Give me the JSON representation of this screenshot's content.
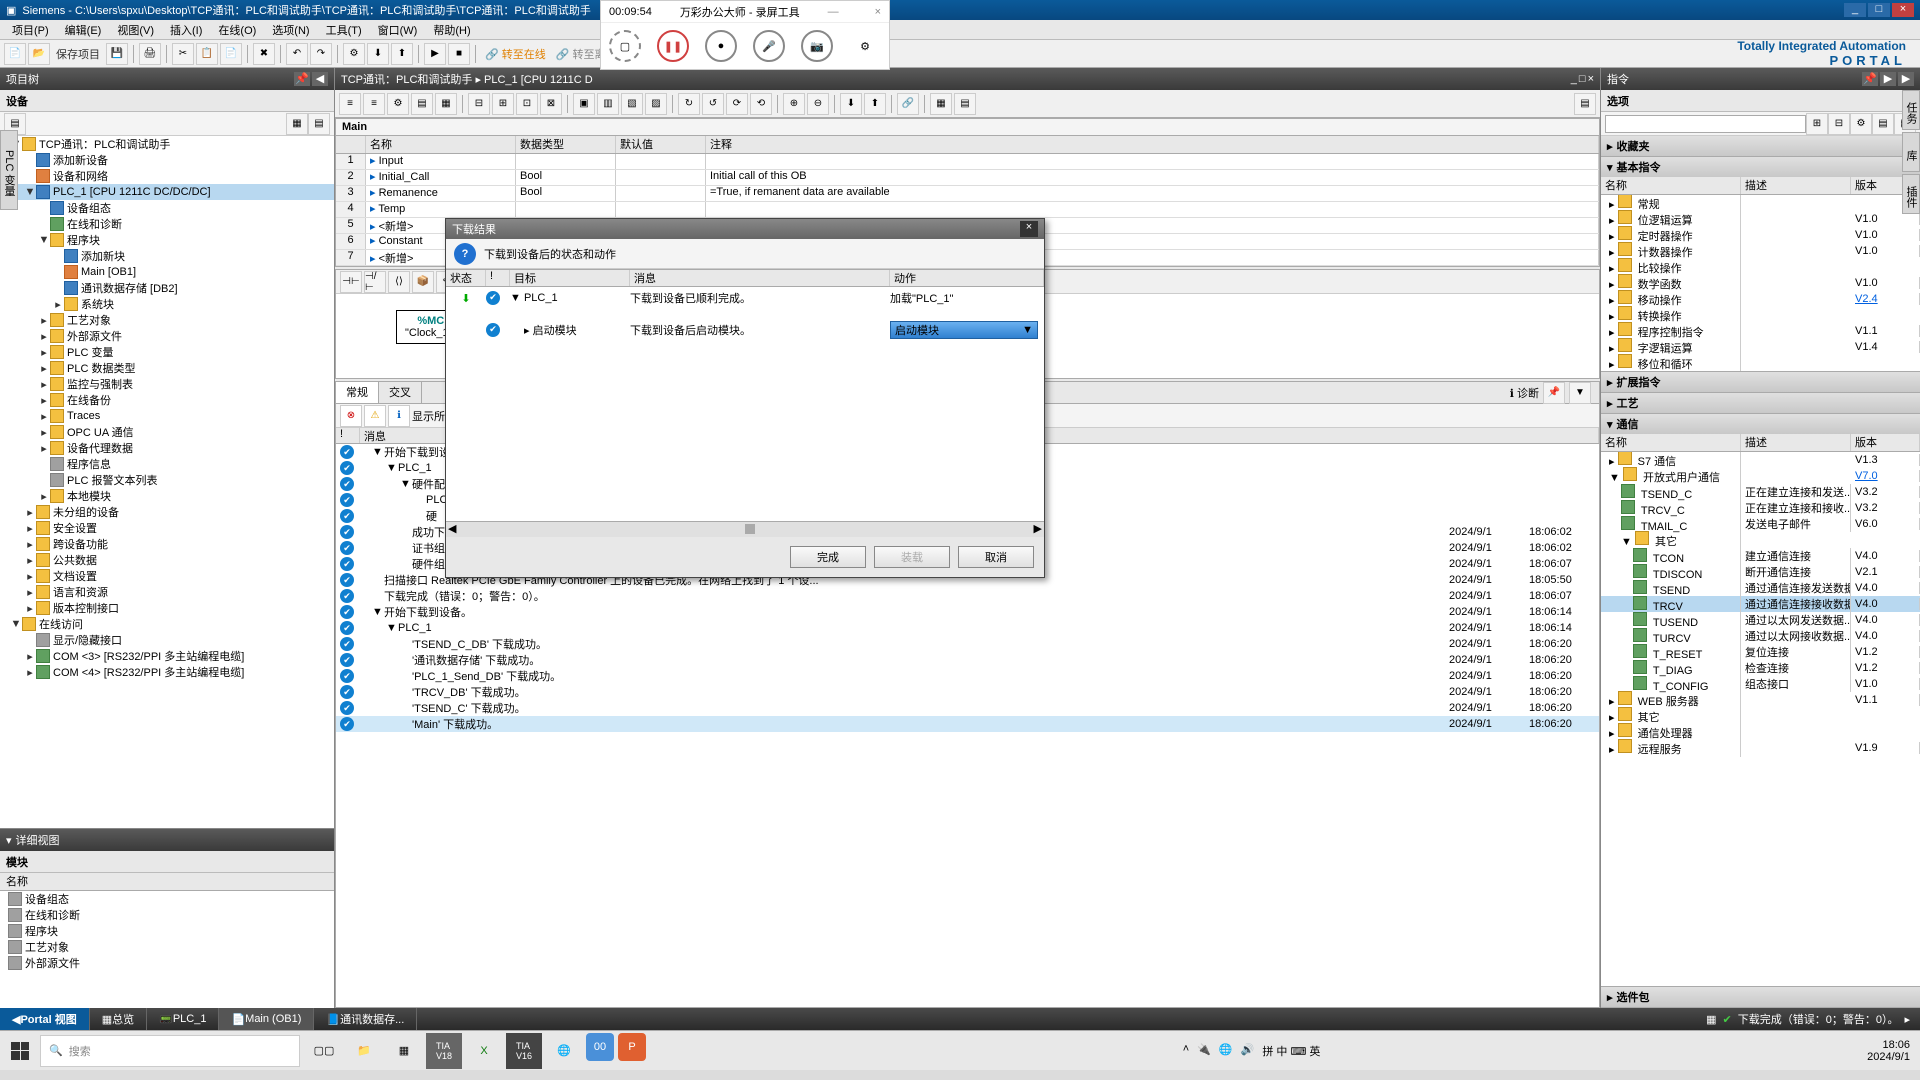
{
  "title": "Siemens  -  C:\\Users\\spxu\\Desktop\\TCP通讯：PLC和调试助手\\TCP通讯：PLC和调试助手\\TCP通讯：PLC和调试助手",
  "menus": [
    "项目(P)",
    "编辑(E)",
    "视图(V)",
    "插入(I)",
    "在线(O)",
    "选项(N)",
    "工具(T)",
    "窗口(W)",
    "帮助(H)"
  ],
  "tb": {
    "save": "保存项目",
    "goonline": "转至在线",
    "gooffline": "转至离线"
  },
  "tia": {
    "line1": "Totally Integrated Automation",
    "line2": "PORTAL"
  },
  "left": {
    "title": "项目树",
    "devices": "设备",
    "detail": "详细视图",
    "module": "模块",
    "name": "名称",
    "tree": [
      {
        "l": 0,
        "e": "▼",
        "i": "ic-folder",
        "t": "TCP通讯：PLC和调试助手"
      },
      {
        "l": 1,
        "e": "",
        "i": "ic-blue",
        "t": "添加新设备"
      },
      {
        "l": 1,
        "e": "",
        "i": "ic-orange",
        "t": "设备和网络"
      },
      {
        "l": 1,
        "e": "▼",
        "i": "ic-blue",
        "t": "PLC_1 [CPU 1211C DC/DC/DC]",
        "sel": true
      },
      {
        "l": 2,
        "e": "",
        "i": "ic-blue",
        "t": "设备组态"
      },
      {
        "l": 2,
        "e": "",
        "i": "ic-green",
        "t": "在线和诊断"
      },
      {
        "l": 2,
        "e": "▼",
        "i": "ic-folder",
        "t": "程序块"
      },
      {
        "l": 3,
        "e": "",
        "i": "ic-blue",
        "t": "添加新块"
      },
      {
        "l": 3,
        "e": "",
        "i": "ic-orange",
        "t": "Main [OB1]"
      },
      {
        "l": 3,
        "e": "",
        "i": "ic-blue",
        "t": "通讯数据存储 [DB2]"
      },
      {
        "l": 3,
        "e": "▸",
        "i": "ic-folder",
        "t": "系统块"
      },
      {
        "l": 2,
        "e": "▸",
        "i": "ic-folder",
        "t": "工艺对象"
      },
      {
        "l": 2,
        "e": "▸",
        "i": "ic-folder",
        "t": "外部源文件"
      },
      {
        "l": 2,
        "e": "▸",
        "i": "ic-folder",
        "t": "PLC 变量"
      },
      {
        "l": 2,
        "e": "▸",
        "i": "ic-folder",
        "t": "PLC 数据类型"
      },
      {
        "l": 2,
        "e": "▸",
        "i": "ic-folder",
        "t": "监控与强制表"
      },
      {
        "l": 2,
        "e": "▸",
        "i": "ic-folder",
        "t": "在线备份"
      },
      {
        "l": 2,
        "e": "▸",
        "i": "ic-folder",
        "t": "Traces"
      },
      {
        "l": 2,
        "e": "▸",
        "i": "ic-folder",
        "t": "OPC UA 通信"
      },
      {
        "l": 2,
        "e": "▸",
        "i": "ic-folder",
        "t": "设备代理数据"
      },
      {
        "l": 2,
        "e": "",
        "i": "ic-gray",
        "t": "程序信息"
      },
      {
        "l": 2,
        "e": "",
        "i": "ic-gray",
        "t": "PLC 报警文本列表"
      },
      {
        "l": 2,
        "e": "▸",
        "i": "ic-folder",
        "t": "本地模块"
      },
      {
        "l": 1,
        "e": "▸",
        "i": "ic-folder",
        "t": "未分组的设备"
      },
      {
        "l": 1,
        "e": "▸",
        "i": "ic-folder",
        "t": "安全设置"
      },
      {
        "l": 1,
        "e": "▸",
        "i": "ic-folder",
        "t": "跨设备功能"
      },
      {
        "l": 1,
        "e": "▸",
        "i": "ic-folder",
        "t": "公共数据"
      },
      {
        "l": 1,
        "e": "▸",
        "i": "ic-folder",
        "t": "文档设置"
      },
      {
        "l": 1,
        "e": "▸",
        "i": "ic-folder",
        "t": "语言和资源"
      },
      {
        "l": 1,
        "e": "▸",
        "i": "ic-folder",
        "t": "版本控制接口"
      },
      {
        "l": 0,
        "e": "▼",
        "i": "ic-folder",
        "t": "在线访问"
      },
      {
        "l": 1,
        "e": "",
        "i": "ic-gray",
        "t": "显示/隐藏接口"
      },
      {
        "l": 1,
        "e": "▸",
        "i": "ic-green",
        "t": "COM <3> [RS232/PPI 多主站编程电缆]"
      },
      {
        "l": 1,
        "e": "▸",
        "i": "ic-green",
        "t": "COM <4> [RS232/PPI 多主站编程电缆]"
      }
    ],
    "detailItems": [
      "设备组态",
      "在线和诊断",
      "程序块",
      "工艺对象",
      "外部源文件"
    ]
  },
  "center": {
    "crumb": "TCP通讯：PLC和调试助手 ▸ PLC_1 [CPU 1211C D",
    "main": "Main",
    "cols": {
      "name": "名称",
      "type": "数据类型",
      "default": "默认值",
      "comment": "注释"
    },
    "rows": [
      {
        "n": "1",
        "name": "Input",
        "type": "",
        "def": "",
        "cm": ""
      },
      {
        "n": "2",
        "name": "  Initial_Call",
        "type": "Bool",
        "def": "",
        "cm": "Initial call of this OB"
      },
      {
        "n": "3",
        "name": "  Remanence",
        "type": "Bool",
        "def": "",
        "cm": "=True, if remanent data are available"
      },
      {
        "n": "4",
        "name": "Temp",
        "type": "",
        "def": "",
        "cm": ""
      },
      {
        "n": "5",
        "name": "  <新增>",
        "type": "",
        "def": "",
        "cm": ""
      },
      {
        "n": "6",
        "name": "Constant",
        "type": "",
        "def": "",
        "cm": ""
      },
      {
        "n": "7",
        "name": "  <新增>",
        "type": "",
        "def": "",
        "cm": ""
      }
    ],
    "clock": {
      "a": "%MC",
      "b": "\"Clock_1H"
    },
    "infotabs": [
      "常规",
      "交叉"
    ],
    "showall": "显示所",
    "msgcol": "消息",
    "msgs": [
      {
        "ind": 1,
        "e": "▼",
        "t": "开始下载到设",
        "d": "",
        "tm": ""
      },
      {
        "ind": 2,
        "e": "▼",
        "t": "PLC_1",
        "d": "",
        "tm": ""
      },
      {
        "ind": 3,
        "e": "▼",
        "t": "硬件配",
        "d": "",
        "tm": ""
      },
      {
        "ind": 4,
        "e": "",
        "t": "PLC",
        "d": "",
        "tm": ""
      },
      {
        "ind": 4,
        "e": "",
        "t": "硬",
        "d": "",
        "tm": ""
      },
      {
        "ind": 3,
        "e": "",
        "t": "成功下载连接组态。",
        "d": "2024/9/1",
        "tm": "18:06:02"
      },
      {
        "ind": 3,
        "e": "",
        "t": "证书组态已成功加载。",
        "d": "2024/9/1",
        "tm": "18:06:02"
      },
      {
        "ind": 3,
        "e": "",
        "t": "硬件组态加载成功。",
        "d": "2024/9/1",
        "tm": "18:06:07"
      },
      {
        "ind": 1,
        "e": "",
        "t": "扫描接口 Realtek PCIe GbE Family Controller 上的设备已完成。在网络上找到了 1 个设...",
        "d": "2024/9/1",
        "tm": "18:05:50"
      },
      {
        "ind": 1,
        "e": "",
        "t": "下载完成（错误：0；警告：0）。",
        "d": "2024/9/1",
        "tm": "18:06:07"
      },
      {
        "ind": 1,
        "e": "▼",
        "t": "开始下载到设备。",
        "d": "2024/9/1",
        "tm": "18:06:14"
      },
      {
        "ind": 2,
        "e": "▼",
        "t": "PLC_1",
        "d": "2024/9/1",
        "tm": "18:06:14"
      },
      {
        "ind": 3,
        "e": "",
        "t": "'TSEND_C_DB' 下载成功。",
        "d": "2024/9/1",
        "tm": "18:06:20"
      },
      {
        "ind": 3,
        "e": "",
        "t": "'通讯数据存储' 下载成功。",
        "d": "2024/9/1",
        "tm": "18:06:20"
      },
      {
        "ind": 3,
        "e": "",
        "t": "'PLC_1_Send_DB' 下载成功。",
        "d": "2024/9/1",
        "tm": "18:06:20"
      },
      {
        "ind": 3,
        "e": "",
        "t": "'TRCV_DB' 下载成功。",
        "d": "2024/9/1",
        "tm": "18:06:20"
      },
      {
        "ind": 3,
        "e": "",
        "t": "'TSEND_C' 下载成功。",
        "d": "2024/9/1",
        "tm": "18:06:20"
      },
      {
        "ind": 3,
        "e": "",
        "t": "'Main' 下载成功。",
        "d": "2024/9/1",
        "tm": "18:06:20",
        "hl": true
      }
    ],
    "diag": "诊断"
  },
  "right": {
    "title": "指令",
    "options": "选项",
    "sections": {
      "fav": "收藏夹",
      "basic": "基本指令",
      "ext": "扩展指令",
      "tech": "工艺",
      "comm": "通信",
      "optpkg": "选件包"
    },
    "cols": {
      "name": "名称",
      "desc": "描述",
      "ver": "版本"
    },
    "basic": [
      {
        "l": 0,
        "e": "▸",
        "t": "常规",
        "v": ""
      },
      {
        "l": 0,
        "e": "▸",
        "t": "位逻辑运算",
        "v": "V1.0"
      },
      {
        "l": 0,
        "e": "▸",
        "t": "定时器操作",
        "v": "V1.0"
      },
      {
        "l": 0,
        "e": "▸",
        "t": "计数器操作",
        "v": "V1.0"
      },
      {
        "l": 0,
        "e": "▸",
        "t": "比较操作",
        "v": ""
      },
      {
        "l": 0,
        "e": "▸",
        "t": "数学函数",
        "v": "V1.0"
      },
      {
        "l": 0,
        "e": "▸",
        "t": "移动操作",
        "v": "V2.4",
        "link": true
      },
      {
        "l": 0,
        "e": "▸",
        "t": "转换操作",
        "v": ""
      },
      {
        "l": 0,
        "e": "▸",
        "t": "程序控制指令",
        "v": "V1.1"
      },
      {
        "l": 0,
        "e": "▸",
        "t": "字逻辑运算",
        "v": "V1.4"
      },
      {
        "l": 0,
        "e": "▸",
        "t": "移位和循环",
        "v": ""
      }
    ],
    "comm": [
      {
        "l": 0,
        "e": "▸",
        "i": "ic-folder",
        "t": "S7 通信",
        "d": "",
        "v": "V1.3"
      },
      {
        "l": 0,
        "e": "▼",
        "i": "ic-folder",
        "t": "开放式用户通信",
        "d": "",
        "v": "V7.0",
        "link": true
      },
      {
        "l": 1,
        "e": "",
        "i": "ic-green",
        "t": "TSEND_C",
        "d": "正在建立连接和发送...",
        "v": "V3.2"
      },
      {
        "l": 1,
        "e": "",
        "i": "ic-green",
        "t": "TRCV_C",
        "d": "正在建立连接和接收...",
        "v": "V3.2"
      },
      {
        "l": 1,
        "e": "",
        "i": "ic-green",
        "t": "TMAIL_C",
        "d": "发送电子邮件",
        "v": "V6.0"
      },
      {
        "l": 1,
        "e": "▼",
        "i": "ic-folder",
        "t": "其它",
        "d": "",
        "v": ""
      },
      {
        "l": 2,
        "e": "",
        "i": "ic-green",
        "t": "TCON",
        "d": "建立通信连接",
        "v": "V4.0"
      },
      {
        "l": 2,
        "e": "",
        "i": "ic-green",
        "t": "TDISCON",
        "d": "断开通信连接",
        "v": "V2.1"
      },
      {
        "l": 2,
        "e": "",
        "i": "ic-green",
        "t": "TSEND",
        "d": "通过通信连接发送数据",
        "v": "V4.0"
      },
      {
        "l": 2,
        "e": "",
        "i": "ic-green",
        "t": "TRCV",
        "d": "通过通信连接接收数据",
        "v": "V4.0",
        "sel": true
      },
      {
        "l": 2,
        "e": "",
        "i": "ic-green",
        "t": "TUSEND",
        "d": "通过以太网发送数据...",
        "v": "V4.0"
      },
      {
        "l": 2,
        "e": "",
        "i": "ic-green",
        "t": "TURCV",
        "d": "通过以太网接收数据...",
        "v": "V4.0"
      },
      {
        "l": 2,
        "e": "",
        "i": "ic-green",
        "t": "T_RESET",
        "d": "复位连接",
        "v": "V1.2"
      },
      {
        "l": 2,
        "e": "",
        "i": "ic-green",
        "t": "T_DIAG",
        "d": "检查连接",
        "v": "V1.2"
      },
      {
        "l": 2,
        "e": "",
        "i": "ic-green",
        "t": "T_CONFIG",
        "d": "组态接口",
        "v": "V1.0"
      },
      {
        "l": 0,
        "e": "▸",
        "i": "ic-folder",
        "t": "WEB 服务器",
        "d": "",
        "v": "V1.1"
      },
      {
        "l": 0,
        "e": "▸",
        "i": "ic-folder",
        "t": "其它",
        "d": "",
        "v": ""
      },
      {
        "l": 0,
        "e": "▸",
        "i": "ic-folder",
        "t": "通信处理器",
        "d": "",
        "v": ""
      },
      {
        "l": 0,
        "e": "▸",
        "i": "ic-folder",
        "t": "远程服务",
        "d": "",
        "v": "V1.9"
      }
    ]
  },
  "dialog": {
    "title": "下载结果",
    "subtitle": "下载到设备后的状态和动作",
    "cols": {
      "status": "状态",
      "target": "目标",
      "msg": "消息",
      "action": "动作"
    },
    "r1": {
      "target": "PLC_1",
      "msg": "下载到设备已顺利完成。",
      "action": "加载\"PLC_1\""
    },
    "r2": {
      "target": "启动模块",
      "msg": "下载到设备后启动模块。",
      "action": "启动模块"
    },
    "btns": {
      "finish": "完成",
      "load": "装载",
      "cancel": "取消"
    }
  },
  "recorder": {
    "time": "00:09:54",
    "title": "万彩办公大师 - 录屏工具"
  },
  "bottom": {
    "portal": "Portal 视图",
    "overview": "总览",
    "plc": "PLC_1",
    "main": "Main (OB1)",
    "comm": "通讯数据存...",
    "status": "下载完成（错误：0；警告：0）。"
  },
  "sidetabs": {
    "left": "PLC 变量",
    "r1": "任务",
    "r2": "库",
    "r3": "插件"
  },
  "taskbar": {
    "search": "搜索",
    "ime": "拼 中 ⌨ 英",
    "time": "18:06",
    "date": "2024/9/1"
  }
}
